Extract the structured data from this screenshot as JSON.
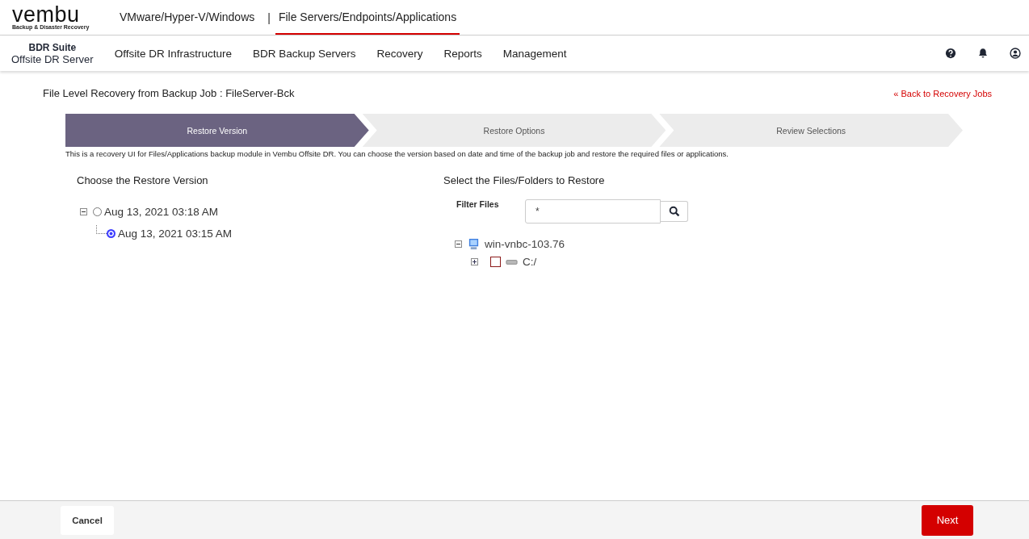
{
  "logo": {
    "name": "vembu",
    "tagline": "Backup & Disaster Recovery"
  },
  "product_tabs": [
    {
      "label": "VMware/Hyper-V/Windows",
      "selected": false
    },
    {
      "label": "File Servers/Endpoints/Applications",
      "selected": true
    }
  ],
  "product_separator": "|",
  "suite": {
    "title": "BDR Suite",
    "subtitle": "Offsite DR Server"
  },
  "nav": [
    "Offsite DR Infrastructure",
    "BDR Backup Servers",
    "Recovery",
    "Reports",
    "Management"
  ],
  "page_title": "File Level Recovery from Backup Job : FileServer-Bck",
  "back_link": "« Back to Recovery Jobs",
  "steps": [
    {
      "label": "Restore Version",
      "selected": true
    },
    {
      "label": "Restore Options",
      "selected": false
    },
    {
      "label": "Review Selections",
      "selected": false
    }
  ],
  "description": "This is a recovery UI for Files/Applications backup module in Vembu Offsite DR. You can choose the version based on date and time of the backup job and restore the required files or applications.",
  "versions": {
    "heading": "Choose the Restore Version",
    "items": [
      {
        "label": "Aug 13, 2021 03:18 AM",
        "selected": false,
        "expanded": true,
        "children": [
          {
            "label": "Aug 13, 2021 03:15 AM",
            "selected": true
          }
        ]
      }
    ]
  },
  "files": {
    "heading": "Select the Files/Folders to Restore",
    "filter_label": "Filter Files",
    "filter_value": "*",
    "tree": [
      {
        "label": "win-vnbc-103.76",
        "kind": "computer",
        "expanded": true,
        "children": [
          {
            "label": "C:/",
            "kind": "drive",
            "expanded": false,
            "checked": false
          }
        ]
      }
    ]
  },
  "footer": {
    "cancel": "Cancel",
    "next": "Next"
  }
}
